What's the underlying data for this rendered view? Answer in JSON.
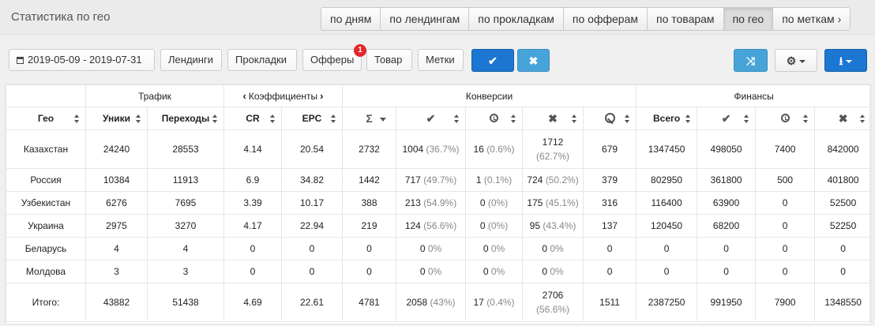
{
  "header": {
    "title": "Статистика по гео"
  },
  "tabs": [
    {
      "label": "по дням"
    },
    {
      "label": "по лендингам"
    },
    {
      "label": "по прокладкам"
    },
    {
      "label": "по офферам"
    },
    {
      "label": "по товарам"
    },
    {
      "label": "по гео",
      "active": true
    },
    {
      "label": "по меткам"
    }
  ],
  "filters": {
    "date_range": "2019-05-09 - 2019-07-31",
    "landings": "Лендинги",
    "prelandings": "Прокладки",
    "offers": "Офферы",
    "offers_badge": "1",
    "product": "Товар",
    "labels": "Метки"
  },
  "colors": {
    "primary": "#1c77d2",
    "info": "#46a4d8",
    "badge": "#e2282b"
  },
  "table": {
    "groups": {
      "traffic": "Трафик",
      "coefficients": "Коэффициенты",
      "conversions": "Конверсии",
      "finance": "Финансы"
    },
    "columns": {
      "geo": "Гео",
      "unique": "Уники",
      "clicks": "Переходы",
      "cr": "CR",
      "epc": "EPC",
      "sum": "Σ",
      "fin_total": "Всего"
    },
    "rows": [
      {
        "geo": "Казахстан",
        "unique": "24240",
        "clicks": "28553",
        "cr": "4.14",
        "epc": "20.54",
        "sum": "2732",
        "approved": "1004",
        "approved_pct": "(36.7%)",
        "hold": "16",
        "hold_pct": "(0.6%)",
        "rejected": "1712",
        "rejected_pct": "(62.7%)",
        "trash": "679",
        "fin_total": "1347450",
        "fin_approved": "498050",
        "fin_hold": "7400",
        "fin_rejected": "842000"
      },
      {
        "geo": "Россия",
        "unique": "10384",
        "clicks": "11913",
        "cr": "6.9",
        "epc": "34.82",
        "sum": "1442",
        "approved": "717",
        "approved_pct": "(49.7%)",
        "hold": "1",
        "hold_pct": "(0.1%)",
        "rejected": "724",
        "rejected_pct": "(50.2%)",
        "trash": "379",
        "fin_total": "802950",
        "fin_approved": "361800",
        "fin_hold": "500",
        "fin_rejected": "401800"
      },
      {
        "geo": "Узбекистан",
        "unique": "6276",
        "clicks": "7695",
        "cr": "3.39",
        "epc": "10.17",
        "sum": "388",
        "approved": "213",
        "approved_pct": "(54.9%)",
        "hold": "0",
        "hold_pct": "(0%)",
        "rejected": "175",
        "rejected_pct": "(45.1%)",
        "trash": "316",
        "fin_total": "116400",
        "fin_approved": "63900",
        "fin_hold": "0",
        "fin_rejected": "52500"
      },
      {
        "geo": "Украина",
        "unique": "2975",
        "clicks": "3270",
        "cr": "4.17",
        "epc": "22.94",
        "sum": "219",
        "approved": "124",
        "approved_pct": "(56.6%)",
        "hold": "0",
        "hold_pct": "(0%)",
        "rejected": "95",
        "rejected_pct": "(43.4%)",
        "trash": "137",
        "fin_total": "120450",
        "fin_approved": "68200",
        "fin_hold": "0",
        "fin_rejected": "52250"
      },
      {
        "geo": "Беларусь",
        "unique": "4",
        "clicks": "4",
        "cr": "0",
        "epc": "0",
        "sum": "0",
        "approved": "0",
        "approved_pct": "0%",
        "hold": "0",
        "hold_pct": "0%",
        "rejected": "0",
        "rejected_pct": "0%",
        "trash": "0",
        "fin_total": "0",
        "fin_approved": "0",
        "fin_hold": "0",
        "fin_rejected": "0"
      },
      {
        "geo": "Молдова",
        "unique": "3",
        "clicks": "3",
        "cr": "0",
        "epc": "0",
        "sum": "0",
        "approved": "0",
        "approved_pct": "0%",
        "hold": "0",
        "hold_pct": "0%",
        "rejected": "0",
        "rejected_pct": "0%",
        "trash": "0",
        "fin_total": "0",
        "fin_approved": "0",
        "fin_hold": "0",
        "fin_rejected": "0"
      }
    ],
    "total": {
      "geo": "Итого:",
      "unique": "43882",
      "clicks": "51438",
      "cr": "4.69",
      "epc": "22.61",
      "sum": "4781",
      "approved": "2058",
      "approved_pct": "(43%)",
      "hold": "17",
      "hold_pct": "(0.4%)",
      "rejected": "2706",
      "rejected_pct": "(56.6%)",
      "trash": "1511",
      "fin_total": "2387250",
      "fin_approved": "991950",
      "fin_hold": "7900",
      "fin_rejected": "1348550"
    }
  }
}
